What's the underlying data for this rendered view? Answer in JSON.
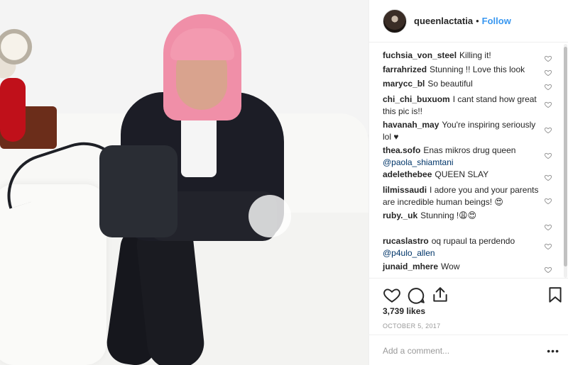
{
  "header": {
    "username": "queenlactatia",
    "separator": "•",
    "follow_label": "Follow"
  },
  "comments": [
    {
      "user": "fuchsia_von_steel",
      "text": "Killing it!"
    },
    {
      "user": "farrahrized",
      "text": "Stunning !! Love this look"
    },
    {
      "user": "marycc_bl",
      "text": "So beautiful"
    },
    {
      "user": "chi_chi_buxuom",
      "text": "I cant stand how great this pic is!!"
    },
    {
      "user": "havanah_may",
      "text": "You're inspiring seriously lol ♥"
    },
    {
      "user": "thea.sofo",
      "text": "Enas mikros drug queen",
      "mention": "@paola_shiamtani"
    },
    {
      "user": "adelethebee",
      "text": "QUEEN SLAY"
    },
    {
      "user": "lilmissaudi",
      "text": "I adore you and your parents are incredible human beings! 😍"
    },
    {
      "user": "ruby._uk",
      "text": "Stunning !😩😍"
    },
    {
      "user": "rucaslastro",
      "text": "oq rupaul ta perdendo",
      "mention": "@p4ulo_allen"
    },
    {
      "user": "junaid_mhere",
      "text": "Wow"
    }
  ],
  "actions": {
    "likes": "3,739 likes",
    "date": "OCTOBER 5, 2017"
  },
  "add_comment": {
    "placeholder": "Add a comment...",
    "more": "•••"
  },
  "icons": {
    "like": "heart-icon",
    "comment": "comment-icon",
    "share": "share-icon",
    "save": "bookmark-icon",
    "comment_like": "heart-outline-icon"
  },
  "colors": {
    "link": "#3897f0",
    "mention": "#003569",
    "text": "#262626",
    "muted": "#999999"
  }
}
